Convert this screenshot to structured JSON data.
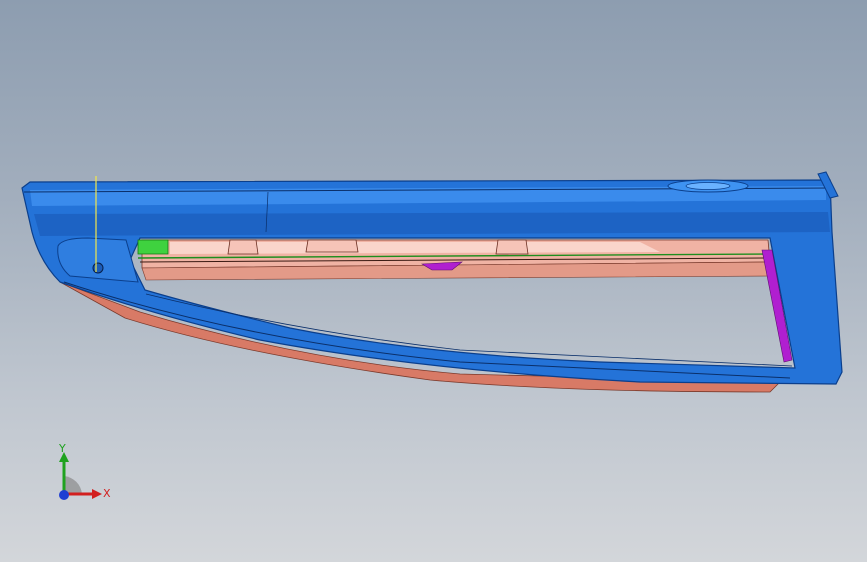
{
  "viewport": {
    "background_top": "#8d9db0",
    "background_bottom": "#d3d6da"
  },
  "model": {
    "description_colors": {
      "body": "#1f6fd6",
      "body_dark": "#0b3f8c",
      "inner_panel": "#e8a89a",
      "lower_trim": "#d87a66",
      "accent_green": "#3fd23f",
      "accent_magenta": "#b01fd0"
    }
  },
  "triad": {
    "x_label": "X",
    "y_label": "Y",
    "x_color": "#d21f1f",
    "y_color": "#1fa21f",
    "z_color": "#1f3fd2"
  }
}
